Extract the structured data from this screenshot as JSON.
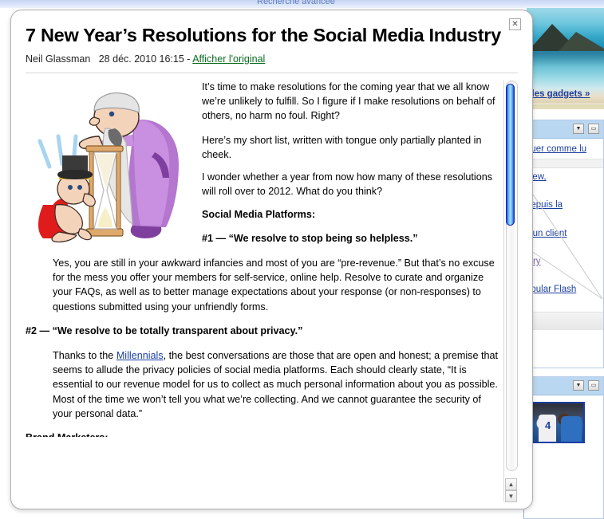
{
  "background": {
    "topbar_text": "Recherche avancée",
    "add_gadgets_link": "r des gadgets »",
    "gadget1": {
      "collapse_icon": "▼",
      "window_icon": "▭",
      "links": [
        "quer comme lu",
        "New,",
        " depuis la",
        " d'un client",
        "stry",
        "opular Flash"
      ]
    },
    "gadget2": {
      "collapse_icon": "▼",
      "window_icon": "▭",
      "thumb_number": "4"
    }
  },
  "modal": {
    "close_label": "✕",
    "title": "7 New Year’s Resolutions for the Social Media Industry",
    "byline_author": "Neil Glassman",
    "byline_date": "28 déc. 2010 16:15",
    "byline_separator": " - ",
    "byline_link": "Afficher l'original",
    "article": {
      "para_wrap": "It’s time to make resolutions for the coming year that we all know we’re unlikely to fulfill. So I figure if I make resolutions on behalf of others, no harm no foul. Right?",
      "para_2": "Here’s my short list, written with tongue only partially planted in cheek.",
      "para_3": "I wonder whether a year from now how many of these resolutions will roll over to 2012. What do you think?",
      "heading_platforms": "Social Media Platforms:",
      "item1_heading": "#1 — “We resolve to stop being so helpless.”",
      "item1_body": "Yes, you are still in your awkward infancies and most of you are “pre-revenue.” But that’s no excuse for the mess you offer your members for self-service, online help. Resolve to curate and organize your FAQs, as well as to better manage expectations about your response (or non-responses) to questions submitted using your unfriendly forms.",
      "item2_heading": "#2 — “We resolve to be totally transparent about privacy.”",
      "item2_body_pre": "Thanks to the ",
      "item2_body_link": "Millennials",
      "item2_body_post": ", the best conversations are those that are open and honest; a premise that seems to allude the privacy policies of social media platforms. Each should clearly state, “It is essential to our revenue model for us to collect as much personal information about you as possible. Most of the time we won’t tell you what we’re collecting. And we cannot guarantee the security of your personal data.”",
      "clipped_heading": "Brand Marketers:"
    },
    "scrollbar": {
      "up_arrow": "▲",
      "down_arrow": "▼"
    }
  },
  "colors": {
    "link_green": "#0a6b1f",
    "link_blue": "#1b3fa0",
    "gadget_header": "#b9d7f0",
    "scroll_thumb": "#3f8fe8"
  }
}
